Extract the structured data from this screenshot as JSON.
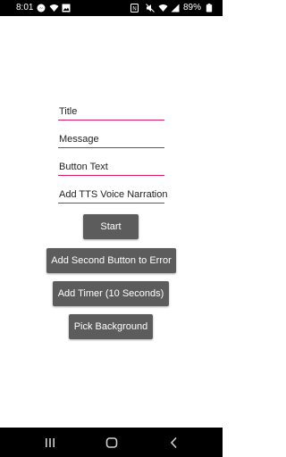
{
  "status_bar": {
    "time": "8:01",
    "battery_percent": "89%",
    "left_icons": [
      "messenger-icon",
      "wifi-icon",
      "gallery-icon"
    ],
    "right_icons": [
      "nfc-icon",
      "mute-icon",
      "wifi-icon",
      "signal-icon",
      "battery-icon"
    ]
  },
  "form": {
    "title_placeholder": "Title",
    "message_placeholder": "Message",
    "button_text_placeholder": "Button Text",
    "tts_placeholder": "Add TTS Voice Narration"
  },
  "buttons": {
    "start": "Start",
    "add_second_button": "Add Second Button to Error",
    "add_timer": "Add Timer (10 Seconds)",
    "pick_background": "Pick Background"
  },
  "nav_bar": {
    "icons": [
      "recents-icon",
      "home-icon",
      "back-icon"
    ]
  },
  "colors": {
    "accent": "#d81b60",
    "button_bg": "#5c5c5c",
    "bar_bg": "#000000"
  }
}
